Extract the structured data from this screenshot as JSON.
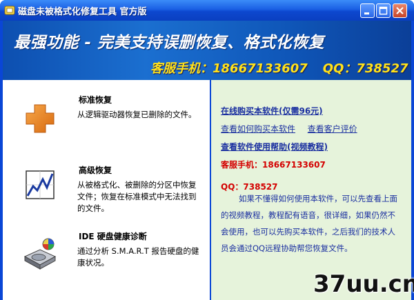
{
  "window": {
    "title": "磁盘未被格式化修复工具 官方版"
  },
  "banner": {
    "headline": "最强功能 - 完美支持误删恢复、格式化恢复",
    "hotline_label": "客服手机：18667133607",
    "qq_label": "QQ：738527"
  },
  "features": [
    {
      "title": "标准恢复",
      "desc": "从逻辑驱动器恢复已删除的文件。",
      "icon": "plus-icon"
    },
    {
      "title": "高级恢复",
      "desc": "从被格式化、被删除的分区中恢复文件；恢复在标准模式中无法找到的文件。",
      "icon": "chart-icon"
    },
    {
      "title": "IDE 硬盘健康诊断",
      "desc": "通过分析 S.M.A.R.T 报告硬盘的健康状况。",
      "icon": "hard-disk-icon"
    }
  ],
  "right_panel": {
    "buy_link": "在线购买本软件(仅需96元)",
    "how_to_buy_link": "查看如何购买本软件",
    "reviews_link": "查看客户评价",
    "help_link": "查看软件使用帮助(视频教程)",
    "hotline": "客服手机：18667133607",
    "qq": "QQ：738527",
    "paragraph": "如果不懂得如何使用本软件，可以先查看上面的视频教程，教程配有语音，很详细，如果仍然不会使用，也可以先购买本软件，之后我们的技术人员会通过QQ远程协助帮您恢复文件。"
  },
  "watermark": {
    "text": "37uu.cn"
  },
  "colors": {
    "title_bar": "#1a5fe4",
    "banner": "#1b6fd0",
    "accent_yellow": "#ffe21a",
    "right_panel_bg": "#e6f3db",
    "link_blue": "#1a2fa0",
    "alert_red": "#d40000"
  }
}
